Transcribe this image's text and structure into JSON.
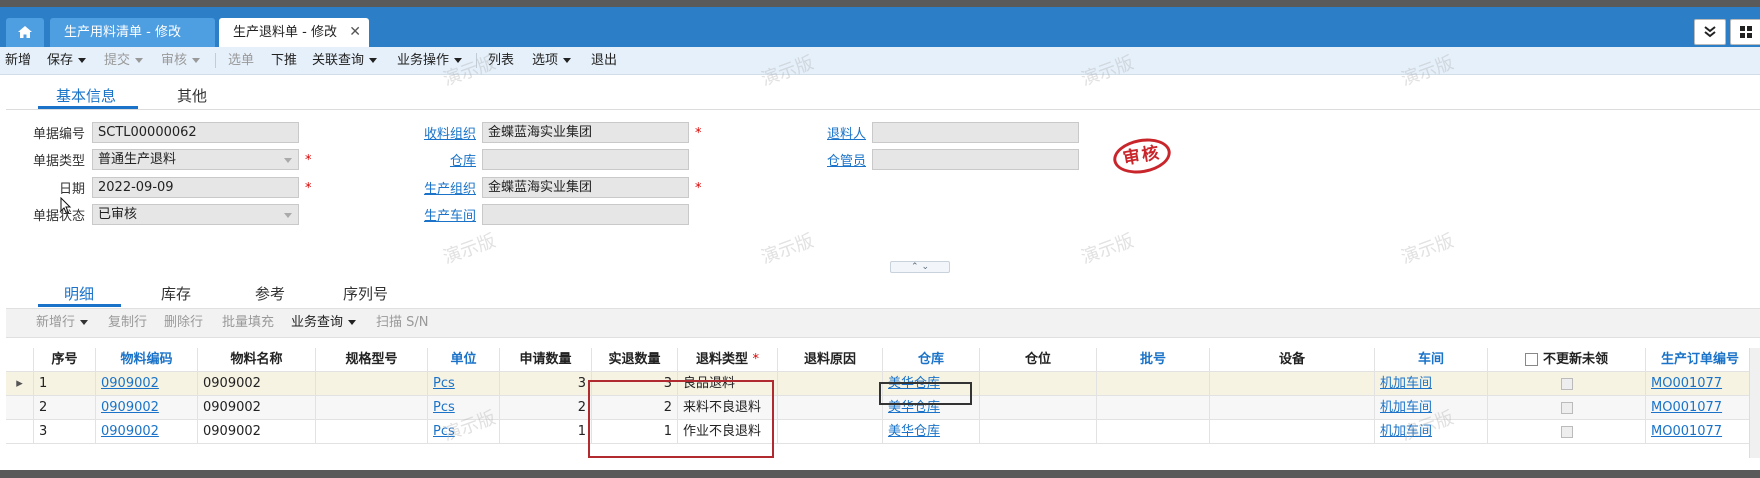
{
  "tabs": [
    {
      "label": "生产用料清单 - 修改"
    },
    {
      "label": "生产退料单 - 修改"
    }
  ],
  "toolbar": {
    "new": "新增",
    "save": "保存",
    "submit": "提交",
    "audit": "审核",
    "select": "选单",
    "push_down": "下推",
    "related_query": "关联查询",
    "business_ops": "业务操作",
    "list": "列表",
    "options": "选项",
    "exit": "退出"
  },
  "section_tabs": {
    "basic": "基本信息",
    "other": "其他"
  },
  "form": {
    "bill_no": {
      "label": "单据编号",
      "value": "SCTL00000062"
    },
    "bill_type": {
      "label": "单据类型",
      "value": "普通生产退料"
    },
    "date": {
      "label": "日期",
      "value": "2022-09-09"
    },
    "status": {
      "label": "单据状态",
      "value": "已审核"
    },
    "receive_org": {
      "label": "收料组织",
      "value": "金蝶蓝海实业集团"
    },
    "warehouse": {
      "label": "仓库",
      "value": ""
    },
    "production_org": {
      "label": "生产组织",
      "value": "金蝶蓝海实业集团"
    },
    "workshop": {
      "label": "生产车间",
      "value": ""
    },
    "returner": {
      "label": "退料人",
      "value": ""
    },
    "keeper": {
      "label": "仓管员",
      "value": ""
    },
    "required_mark": "*"
  },
  "stamp_text": "审核",
  "detail_tabs": {
    "detail": "明细",
    "inventory": "库存",
    "reference": "参考",
    "serial": "序列号"
  },
  "grid_toolbar": {
    "add_row": "新增行",
    "copy_row": "复制行",
    "delete_row": "删除行",
    "batch_fill": "批量填充",
    "business_query": "业务查询",
    "scan_sn": "扫描 S/N"
  },
  "grid": {
    "headers": {
      "seq": "序号",
      "material_code": "物料编码",
      "material_name": "物料名称",
      "spec": "规格型号",
      "unit": "单位",
      "apply_qty": "申请数量",
      "actual_qty": "实退数量",
      "return_type": "退料类型",
      "return_reason": "退料原因",
      "warehouse": "仓库",
      "location": "仓位",
      "lot": "批号",
      "equipment": "设备",
      "workshop": "车间",
      "not_update": "不更新未领",
      "order_no": "生产订单编号"
    },
    "rows": [
      {
        "seq": "1",
        "material_code": "0909002",
        "material_name": "0909002",
        "spec": "",
        "unit": "Pcs",
        "apply_qty": "3",
        "actual_qty": "3",
        "return_type": "良品退料",
        "return_reason": "",
        "warehouse": "美华仓库",
        "location": "",
        "lot": "",
        "equipment": "",
        "workshop": "机加车间",
        "order_no": "MO001077"
      },
      {
        "seq": "2",
        "material_code": "0909002",
        "material_name": "0909002",
        "spec": "",
        "unit": "Pcs",
        "apply_qty": "2",
        "actual_qty": "2",
        "return_type": "来料不良退料",
        "return_reason": "",
        "warehouse": "美华仓库",
        "location": "",
        "lot": "",
        "equipment": "",
        "workshop": "机加车间",
        "order_no": "MO001077"
      },
      {
        "seq": "3",
        "material_code": "0909002",
        "material_name": "0909002",
        "spec": "",
        "unit": "Pcs",
        "apply_qty": "1",
        "actual_qty": "1",
        "return_type": "作业不良退料",
        "return_reason": "",
        "warehouse": "美华仓库",
        "location": "",
        "lot": "",
        "equipment": "",
        "workshop": "机加车间",
        "order_no": "MO001077"
      }
    ]
  },
  "watermark": "演示版",
  "colors": {
    "tab_bar": "#2c7fc7",
    "link": "#1a73c8",
    "required": "#dd0000",
    "highlight_box": "#b02a30",
    "stamp": "#c9262c"
  }
}
